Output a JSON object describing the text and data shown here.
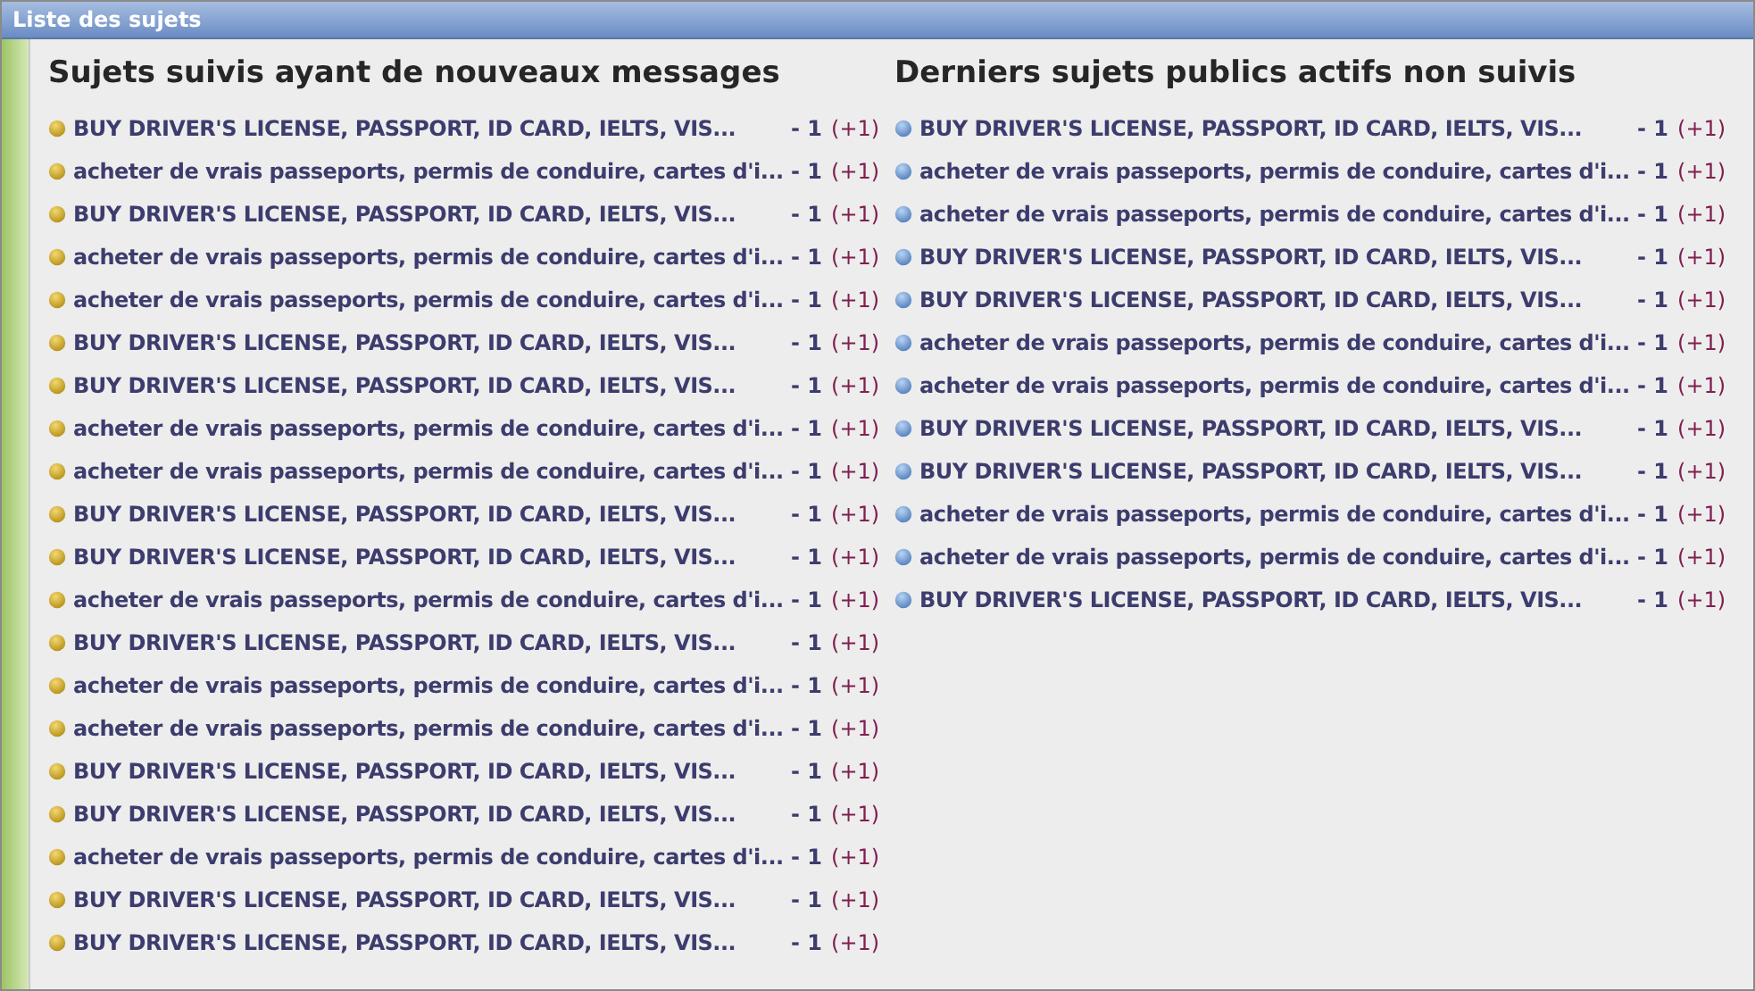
{
  "window": {
    "title": "Liste des sujets"
  },
  "sections": [
    {
      "kind": "followed",
      "heading": "Sujets suivis ayant de nouveaux messages",
      "topics": [
        {
          "title": "BUY DRIVER'S LICENSE, PASSPORT, ID CARD, IELTS, VIS...",
          "count": "- 1",
          "new": "(+1)"
        },
        {
          "title": "acheter de vrais passeports, permis de conduire, cartes d'i...",
          "count": "- 1",
          "new": "(+1)"
        },
        {
          "title": "BUY DRIVER'S LICENSE, PASSPORT, ID CARD, IELTS, VIS...",
          "count": "- 1",
          "new": "(+1)"
        },
        {
          "title": "acheter de vrais passeports, permis de conduire, cartes d'i...",
          "count": "- 1",
          "new": "(+1)"
        },
        {
          "title": "acheter de vrais passeports, permis de conduire, cartes d'i...",
          "count": "- 1",
          "new": "(+1)"
        },
        {
          "title": "BUY DRIVER'S LICENSE, PASSPORT, ID CARD, IELTS, VIS...",
          "count": "- 1",
          "new": "(+1)"
        },
        {
          "title": "BUY DRIVER'S LICENSE, PASSPORT, ID CARD, IELTS, VIS...",
          "count": "- 1",
          "new": "(+1)"
        },
        {
          "title": "acheter de vrais passeports, permis de conduire, cartes d'i...",
          "count": "- 1",
          "new": "(+1)"
        },
        {
          "title": "acheter de vrais passeports, permis de conduire, cartes d'i...",
          "count": "- 1",
          "new": "(+1)"
        },
        {
          "title": "BUY DRIVER'S LICENSE, PASSPORT, ID CARD, IELTS, VIS...",
          "count": "- 1",
          "new": "(+1)"
        },
        {
          "title": "BUY DRIVER'S LICENSE, PASSPORT, ID CARD, IELTS, VIS...",
          "count": "- 1",
          "new": "(+1)"
        },
        {
          "title": "acheter de vrais passeports, permis de conduire, cartes d'i...",
          "count": "- 1",
          "new": "(+1)"
        },
        {
          "title": "BUY DRIVER'S LICENSE, PASSPORT, ID CARD, IELTS, VIS...",
          "count": "- 1",
          "new": "(+1)"
        },
        {
          "title": "acheter de vrais passeports, permis de conduire, cartes d'i...",
          "count": "- 1",
          "new": "(+1)"
        },
        {
          "title": "acheter de vrais passeports, permis de conduire, cartes d'i...",
          "count": "- 1",
          "new": "(+1)"
        },
        {
          "title": "BUY DRIVER'S LICENSE, PASSPORT, ID CARD, IELTS, VIS...",
          "count": "- 1",
          "new": "(+1)"
        },
        {
          "title": "BUY DRIVER'S LICENSE, PASSPORT, ID CARD, IELTS, VIS...",
          "count": "- 1",
          "new": "(+1)"
        },
        {
          "title": "acheter de vrais passeports, permis de conduire, cartes d'i...",
          "count": "- 1",
          "new": "(+1)"
        },
        {
          "title": "BUY DRIVER'S LICENSE, PASSPORT, ID CARD, IELTS, VIS...",
          "count": "- 1",
          "new": "(+1)"
        },
        {
          "title": "BUY DRIVER'S LICENSE, PASSPORT, ID CARD, IELTS, VIS...",
          "count": "- 1",
          "new": "(+1)"
        }
      ]
    },
    {
      "kind": "public",
      "heading": "Derniers sujets publics actifs non suivis",
      "topics": [
        {
          "title": "BUY DRIVER'S LICENSE, PASSPORT, ID CARD, IELTS, VIS...",
          "count": "- 1",
          "new": "(+1)"
        },
        {
          "title": "acheter de vrais passeports, permis de conduire, cartes d'i...",
          "count": "- 1",
          "new": "(+1)"
        },
        {
          "title": "acheter de vrais passeports, permis de conduire, cartes d'i...",
          "count": "- 1",
          "new": "(+1)"
        },
        {
          "title": "BUY DRIVER'S LICENSE, PASSPORT, ID CARD, IELTS, VIS...",
          "count": "- 1",
          "new": "(+1)"
        },
        {
          "title": "BUY DRIVER'S LICENSE, PASSPORT, ID CARD, IELTS, VIS...",
          "count": "- 1",
          "new": "(+1)"
        },
        {
          "title": "acheter de vrais passeports, permis de conduire, cartes d'i...",
          "count": "- 1",
          "new": "(+1)"
        },
        {
          "title": "acheter de vrais passeports, permis de conduire, cartes d'i...",
          "count": "- 1",
          "new": "(+1)"
        },
        {
          "title": "BUY DRIVER'S LICENSE, PASSPORT, ID CARD, IELTS, VIS...",
          "count": "- 1",
          "new": "(+1)"
        },
        {
          "title": "BUY DRIVER'S LICENSE, PASSPORT, ID CARD, IELTS, VIS...",
          "count": "- 1",
          "new": "(+1)"
        },
        {
          "title": "acheter de vrais passeports, permis de conduire, cartes d'i...",
          "count": "- 1",
          "new": "(+1)"
        },
        {
          "title": "acheter de vrais passeports, permis de conduire, cartes d'i...",
          "count": "- 1",
          "new": "(+1)"
        },
        {
          "title": "BUY DRIVER'S LICENSE, PASSPORT, ID CARD, IELTS, VIS...",
          "count": "- 1",
          "new": "(+1)"
        }
      ]
    }
  ]
}
